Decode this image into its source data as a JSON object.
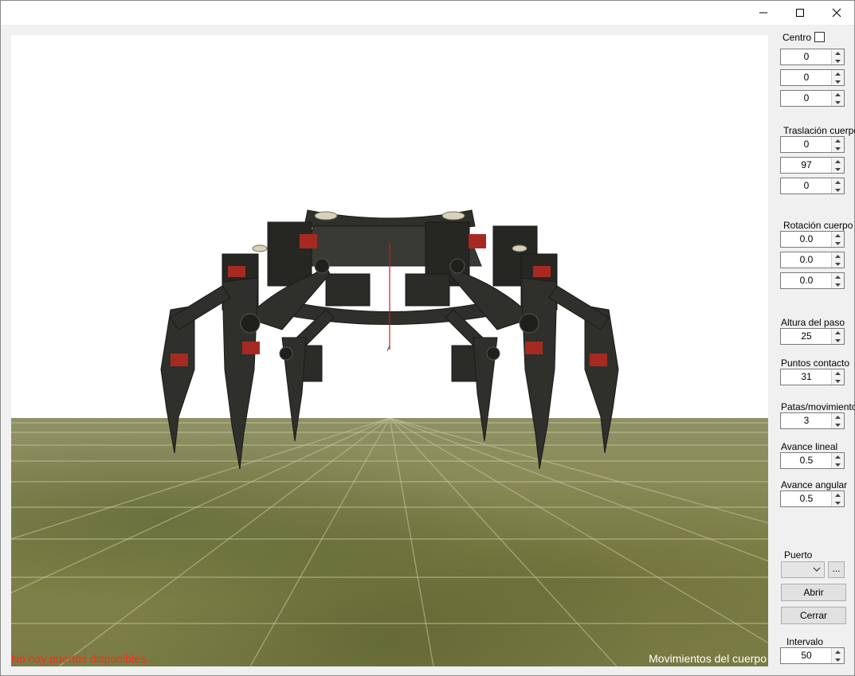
{
  "window": {
    "controls": [
      "minimize-icon",
      "maximize-icon",
      "close-icon"
    ]
  },
  "viewport": {
    "status_error": "No hay puertos disponibles...",
    "mode_label": "Movimientos del cuerpo"
  },
  "centro": {
    "label": "Centro",
    "checked": false,
    "values": [
      "0",
      "0",
      "0"
    ]
  },
  "traslacion": {
    "label": "Traslación cuerpo",
    "values": [
      "0",
      "97",
      "0"
    ]
  },
  "rotacion": {
    "label": "Rotación cuerpo",
    "values": [
      "0.0",
      "0.0",
      "0.0"
    ]
  },
  "altura_paso": {
    "label": "Altura del paso",
    "value": "25"
  },
  "puntos_contacto": {
    "label": "Puntos contacto",
    "value": "31"
  },
  "patas_movimiento": {
    "label": "Patas/movimiento",
    "value": "3"
  },
  "avance_lineal": {
    "label": "Avance lineal",
    "value": "0.5"
  },
  "avance_angular": {
    "label": "Avance angular",
    "value": "0.5"
  },
  "puerto": {
    "label": "Puerto",
    "selected": "",
    "browse_label": "...",
    "open_label": "Abrir",
    "close_label": "Cerrar"
  },
  "intervalo": {
    "label": "Intervalo",
    "value": "50"
  },
  "colors": {
    "error_text": "#ff2a1a",
    "floor": "#7f8348",
    "robot": "#2f2f2b"
  }
}
